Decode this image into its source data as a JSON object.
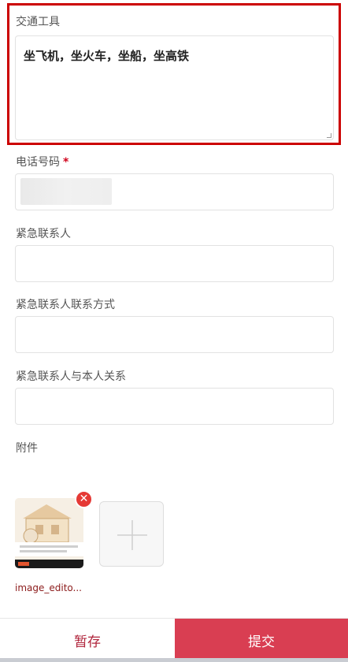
{
  "form": {
    "transport": {
      "label": "交通工具",
      "value": "坐飞机，坐火车，坐船，坐高铁"
    },
    "phone": {
      "label": "电话号码",
      "required_mark": "*",
      "value": ""
    },
    "emergency_contact": {
      "label": "紧急联系人",
      "value": ""
    },
    "emergency_contact_method": {
      "label": "紧急联系人联系方式",
      "value": ""
    },
    "emergency_relation": {
      "label": "紧急联系人与本人关系",
      "value": ""
    },
    "attachments": {
      "label": "附件",
      "files": [
        {
          "name": "image_edito...",
          "icon": "image-thumbnail"
        }
      ],
      "remove_icon": "close-circle-icon",
      "add_icon": "plus-icon"
    }
  },
  "footer": {
    "save_label": "暂存",
    "submit_label": "提交"
  },
  "colors": {
    "highlight": "#cc0000",
    "primary": "#d93e52",
    "save_text": "#b0243b",
    "remove": "#e53935"
  }
}
